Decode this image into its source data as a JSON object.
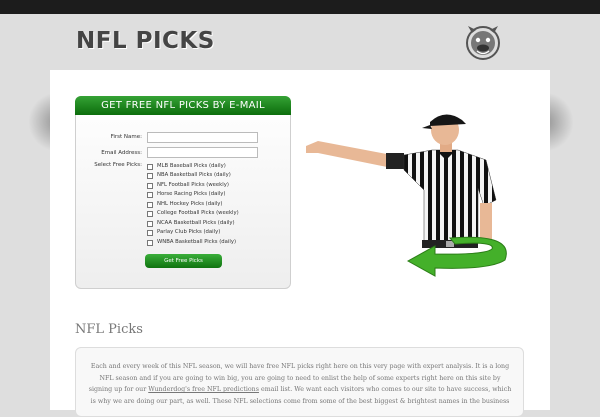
{
  "header": {
    "site_title": "NFL PICKS"
  },
  "form": {
    "title": "GET FREE NFL PICKS BY E-MAIL",
    "first_name_label": "First Name:",
    "email_label": "Email Address:",
    "select_label": "Select Free Picks:",
    "first_name_value": "",
    "email_value": "",
    "options": [
      {
        "label": "MLB Baseball Picks (daily)",
        "checked": false
      },
      {
        "label": "NBA Basketball Picks (daily)",
        "checked": false
      },
      {
        "label": "NFL Football Picks (weekly)",
        "checked": false
      },
      {
        "label": "Horse Racing Picks (daily)",
        "checked": false
      },
      {
        "label": "NHL Hockey Picks (daily)",
        "checked": false
      },
      {
        "label": "College Football Picks (weekly)",
        "checked": false
      },
      {
        "label": "NCAA Basketball Picks (daily)",
        "checked": false
      },
      {
        "label": "Parlay Club Picks (daily)",
        "checked": false
      },
      {
        "label": "WNBA Basketball Picks (daily)",
        "checked": false
      }
    ],
    "submit_label": "Get Free Picks",
    "header_color": "#1f8a1f"
  },
  "section": {
    "title": "NFL Picks",
    "para_before": "Each and every week of this NFL season, we will have free NFL picks right here on this very page with expert analysis. It is a long NFL season and if you are going to win big, you are going to need to enlist the help of some experts right here on this site by signing up for our ",
    "link_text": "Wunderdog's free NFL predictions",
    "para_after": " email list. We want each visitors who comes to our site to have success, which is why we are doing our part, as well. These NFL selections come from some of the best biggest & brightest names in the business"
  },
  "icons": {
    "logo": "bulldog-logo-icon",
    "referee": "referee-image",
    "arrow": "green-arrow-icon"
  }
}
